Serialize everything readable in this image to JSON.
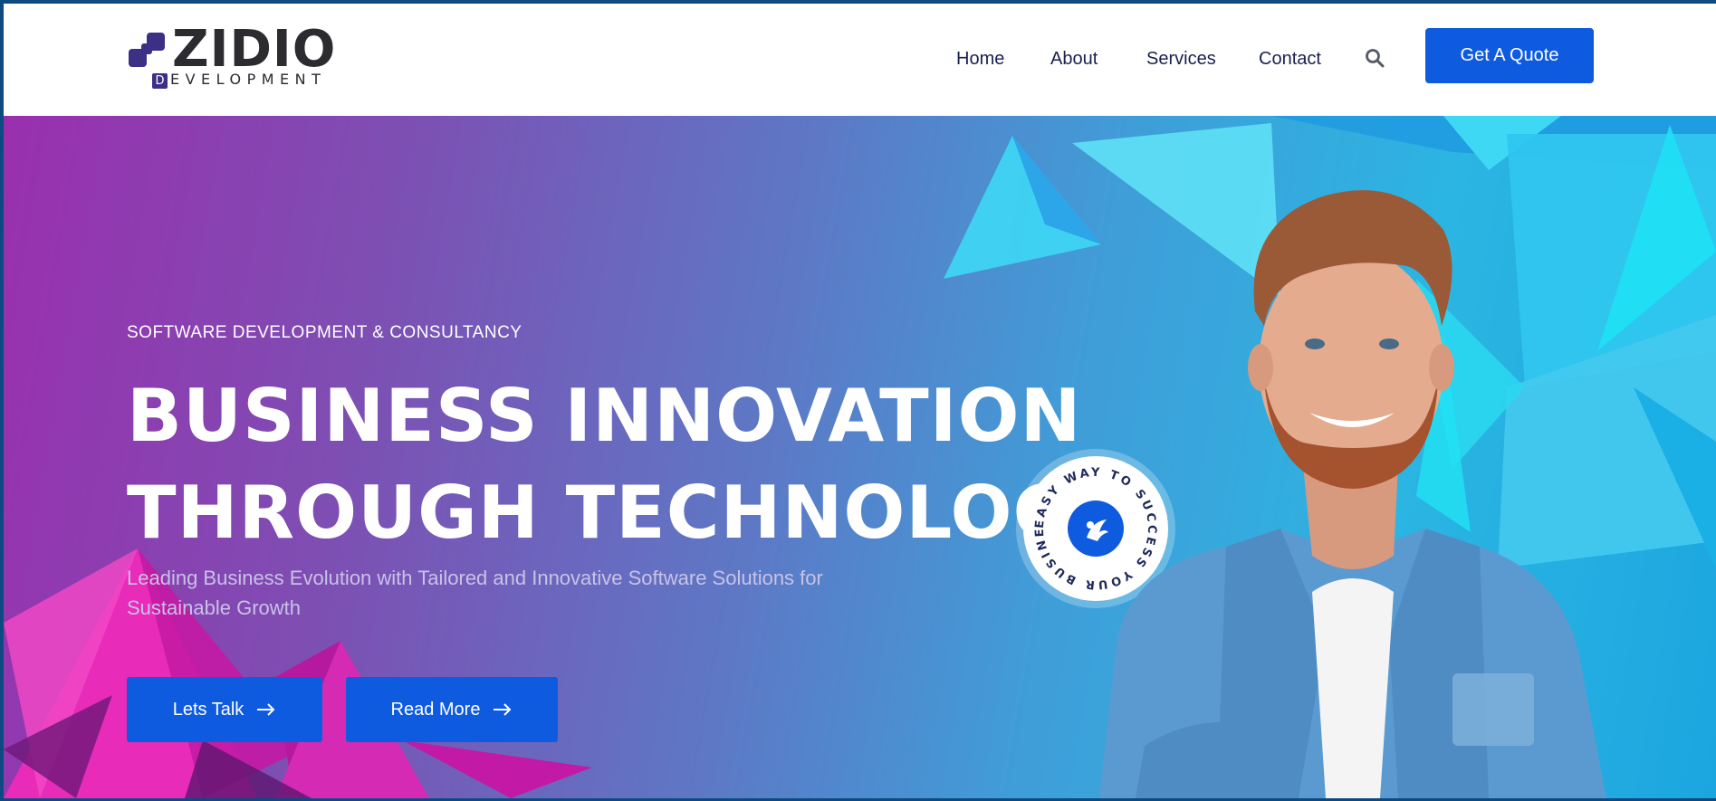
{
  "brand": {
    "name": "ZIDIO",
    "sub_initial": "D",
    "sub_rest": "EVELOPMENT"
  },
  "nav": {
    "items": [
      {
        "label": "Home"
      },
      {
        "label": "About"
      },
      {
        "label": "Services"
      },
      {
        "label": "Contact"
      }
    ],
    "search_icon": "search-icon",
    "cta_label": "Get A Quote"
  },
  "hero": {
    "eyebrow": "SOFTWARE DEVELOPMENT & CONSULTANCY",
    "headline_line1": "BUSINESS INNOVATION",
    "headline_line2": "THROUGH TECHNOLOGY",
    "subtitle": "Leading Business Evolution with Tailored and Innovative Software Solutions for Sustainable Growth",
    "primary_button": "Lets Talk",
    "secondary_button": "Read More",
    "badge_text": "EASY WAY TO SUCCESS YOUR BUSINESS "
  },
  "colors": {
    "accent": "#0e5be0",
    "nav_text": "#1a2050",
    "brand_dark": "#2b2b30",
    "brand_purple": "#3b2f86",
    "hero_left": "#9a2fae",
    "hero_right": "#1ca6e0"
  }
}
